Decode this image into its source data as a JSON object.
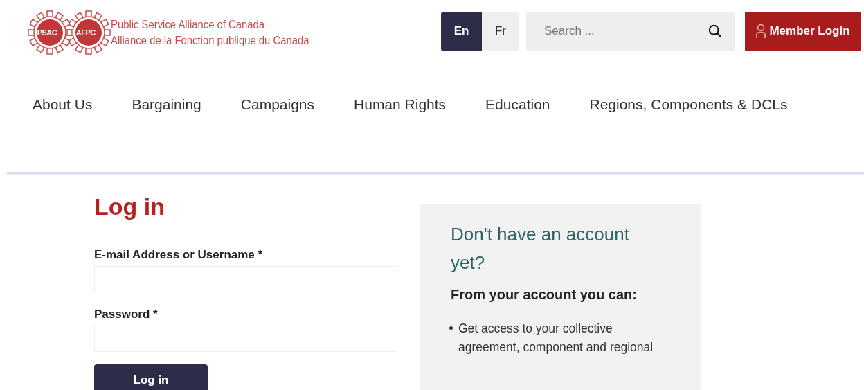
{
  "logo": {
    "badges": [
      "PSAC",
      "AFPC"
    ],
    "lines": [
      "Public Service Alliance of Canada",
      "Alliance de la Fonction publique du Canada"
    ]
  },
  "languages": [
    {
      "label": "En",
      "selected": true
    },
    {
      "label": "Fr",
      "selected": false
    }
  ],
  "search": {
    "placeholder": "Search ..."
  },
  "member_login": "Member Login",
  "nav": [
    "About Us",
    "Bargaining",
    "Campaigns",
    "Human Rights",
    "Education",
    "Regions, Components & DCLs"
  ],
  "title": "Log in",
  "form": {
    "fields": [
      {
        "label": "E-mail Address or Username *"
      },
      {
        "label": "Password *"
      }
    ],
    "submit": "Log in"
  },
  "aside": {
    "heading": "Don't have an account yet?",
    "subheading": "From your account you can:",
    "bullets": [
      "Get access to your collective agreement, component and regional"
    ]
  }
}
